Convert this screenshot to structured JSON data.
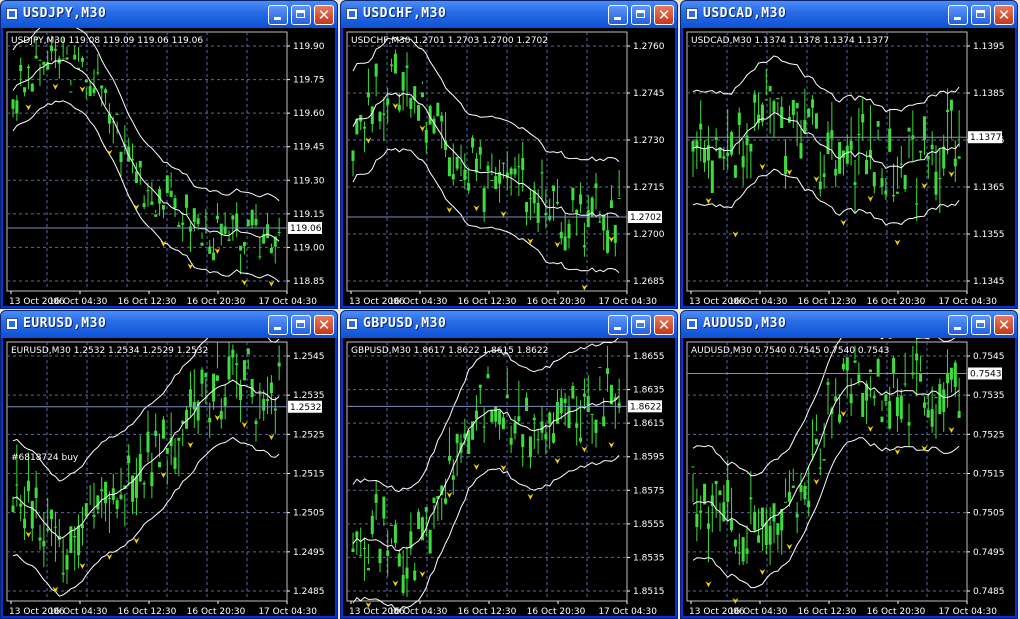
{
  "colors": {
    "grid": "#5a6aa0",
    "candle": "#3ddc3d",
    "band": "#ffffff",
    "arrow": "#f0d000",
    "price_box": "#ffffff"
  },
  "windows": [
    {
      "id": "usdjpy",
      "title": "USDJPY,M30",
      "header": "USDJPY,M30  119.08 119.09 119.06 119.06",
      "y_ticks": [
        "119.90",
        "119.75",
        "119.60",
        "119.45",
        "119.30",
        "119.15",
        "119.00",
        "118.85"
      ],
      "current_price": "119.06",
      "x_ticks": [
        "13 Oct 2006",
        "16 Oct 04:30",
        "16 Oct 12:30",
        "16 Oct 20:30",
        "17 Oct 04:30"
      ],
      "chart_data": {
        "type": "candlestick",
        "ylim": [
          118.78,
          119.93
        ],
        "trend": [
          119.62,
          119.78,
          119.8,
          119.72,
          119.45,
          119.25,
          119.15,
          119.05,
          119.0,
          119.02,
          119.05
        ],
        "band_width": 0.18,
        "volatility": 0.09
      },
      "annotation": ""
    },
    {
      "id": "usdchf",
      "title": "USDCHF,M30",
      "header": "USDCHF,M30  1.2701 1.2703 1.2700 1.2702",
      "y_ticks": [
        "1.2760",
        "1.2745",
        "1.2730",
        "1.2715",
        "1.2700",
        "1.2685"
      ],
      "current_price": "1.2702",
      "x_ticks": [
        "13 Oct 2006",
        "16 Oct 04:30",
        "16 Oct 12:30",
        "16 Oct 20:30",
        "17 Oct 04:30"
      ],
      "chart_data": {
        "type": "candlestick",
        "ylim": [
          1.2678,
          1.2762
        ],
        "trend": [
          1.273,
          1.2742,
          1.2745,
          1.2735,
          1.2722,
          1.2715,
          1.2712,
          1.2708,
          1.2703,
          1.27,
          1.2702
        ],
        "band_width": 0.0018,
        "volatility": 0.0009
      },
      "annotation": ""
    },
    {
      "id": "usdcad",
      "title": "USDCAD,M30",
      "header": "USDCAD,M30  1.1374 1.1378 1.1374 1.1377",
      "y_ticks": [
        "1.1395",
        "1.1385",
        "1.1375",
        "1.1365",
        "1.1355",
        "1.1345"
      ],
      "current_price": "1.1377",
      "x_ticks": [
        "13 Oct 2006",
        "16 Oct 04:30",
        "16 Oct 12:30",
        "16 Oct 20:30",
        "17 Oct 04:30"
      ],
      "chart_data": {
        "type": "candlestick",
        "ylim": [
          1.1339,
          1.1403
        ],
        "trend": [
          1.1372,
          1.1368,
          1.1375,
          1.1382,
          1.1378,
          1.1372,
          1.1376,
          1.137,
          1.1368,
          1.1375,
          1.1377
        ],
        "band_width": 0.0014,
        "volatility": 0.0009
      },
      "annotation": ""
    },
    {
      "id": "eurusd",
      "title": "EURUSD,M30",
      "header": "EURUSD,M30  1.2532 1.2534 1.2529 1.2532",
      "y_ticks": [
        "1.2545",
        "1.2535",
        "1.2525",
        "1.2515",
        "1.2505",
        "1.2495",
        "1.2485"
      ],
      "current_price": "1.2532",
      "x_ticks": [
        "13 Oct 2006",
        "16 Oct 04:30",
        "16 Oct 12:30",
        "16 Oct 20:30",
        "17 Oct 04:30"
      ],
      "chart_data": {
        "type": "candlestick",
        "ylim": [
          1.2478,
          1.255
        ],
        "trend": [
          1.2508,
          1.25,
          1.2492,
          1.2502,
          1.2512,
          1.2518,
          1.2524,
          1.253,
          1.2538,
          1.2536,
          1.2532
        ],
        "band_width": 0.0016,
        "volatility": 0.0009
      },
      "annotation": "#6818724 buy"
    },
    {
      "id": "gbpusd",
      "title": "GBPUSD,M30",
      "header": "GBPUSD,M30  1.8617 1.8622 1.8615 1.8622",
      "y_ticks": [
        "1.8655",
        "1.8635",
        "1.8615",
        "1.8595",
        "1.8575",
        "1.8555",
        "1.8535",
        "1.8515"
      ],
      "current_price": "1.8622",
      "x_ticks": [
        "13 Oct 2006",
        "16 Oct 04:30",
        "16 Oct 12:30",
        "16 Oct 20:30",
        "17 Oct 04:30"
      ],
      "chart_data": {
        "type": "candlestick",
        "ylim": [
          1.8507,
          1.866
        ],
        "trend": [
          1.856,
          1.8545,
          1.853,
          1.8555,
          1.86,
          1.863,
          1.861,
          1.8605,
          1.8618,
          1.8625,
          1.8622
        ],
        "band_width": 0.0035,
        "volatility": 0.0018
      },
      "annotation": ""
    },
    {
      "id": "audusd",
      "title": "AUDUSD,M30",
      "header": "AUDUSD,M30  0.7540 0.7545 0.7540 0.7543",
      "y_ticks": [
        "0.7545",
        "0.7535",
        "0.7525",
        "0.7515",
        "0.7505",
        "0.7495",
        "0.7485"
      ],
      "current_price": "0.7543",
      "x_ticks": [
        "13 Oct 2006",
        "16 Oct 04:30",
        "16 Oct 12:30",
        "16 Oct 20:30",
        "17 Oct 04:30"
      ],
      "chart_data": {
        "type": "candlestick",
        "ylim": [
          1.0,
          1.0
        ],
        "trend": [],
        "band_width": 0.0,
        "volatility": 0.0
      },
      "annotation": ""
    }
  ]
}
